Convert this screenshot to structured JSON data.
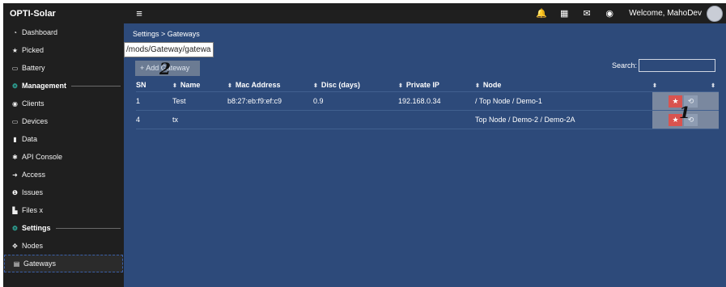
{
  "header": {
    "brand": "OPTI-Solar",
    "menu_icon": "≡",
    "icons": [
      {
        "name": "bell-icon",
        "glyph": "🔔"
      },
      {
        "name": "calendar-icon",
        "glyph": "▦"
      },
      {
        "name": "envelope-icon",
        "glyph": "✉"
      },
      {
        "name": "globe-icon",
        "glyph": "◉"
      }
    ],
    "welcome": "Welcome, MahoDev"
  },
  "sidebar": {
    "items": [
      {
        "label": "Dashboard",
        "icon": "◔"
      },
      {
        "label": "Picked",
        "icon": "★"
      },
      {
        "label": "Battery",
        "icon": "▭"
      }
    ],
    "section_management": {
      "label": "Management",
      "icon": "⚙"
    },
    "management_items": [
      {
        "label": "Clients",
        "icon": "◉"
      },
      {
        "label": "Devices",
        "icon": "▭"
      },
      {
        "label": "Data",
        "icon": "▮"
      },
      {
        "label": "API Console",
        "icon": "✱"
      },
      {
        "label": "Access",
        "icon": "➜"
      },
      {
        "label": "Issues",
        "icon": "❶"
      },
      {
        "label": "Files x",
        "icon": "▙"
      }
    ],
    "section_settings": {
      "label": "Settings",
      "icon": "⚙"
    },
    "settings_items": [
      {
        "label": "Nodes",
        "icon": "✥"
      },
      {
        "label": "Gateways",
        "icon": "▤"
      }
    ]
  },
  "main": {
    "breadcrumb": "Settings > Gateways",
    "path_overlay": "/mods/Gateway/gatewa",
    "add_button": "+ Add Gateway",
    "marker_1": "1",
    "marker_2": "2",
    "search_label": "Search:",
    "search_value": "",
    "columns": [
      "SN",
      "Name",
      "Mac Address",
      "Disc (days)",
      "Private IP",
      "Node",
      "",
      ""
    ],
    "rows": [
      {
        "sn": "1",
        "name": "Test",
        "mac": "b8:27:eb:f9:ef:c9",
        "disc": "0.9",
        "ip": "192.168.0.34",
        "node": "/ Top Node / Demo-1"
      },
      {
        "sn": "4",
        "name": "tx",
        "mac": "",
        "disc": "",
        "ip": "",
        "node": "Top Node / Demo-2 / Demo-2A"
      }
    ],
    "fav_icon": "★",
    "history_icon": "⟲",
    "sort_icon": "⬍"
  },
  "colors": {
    "topbar": "#1f1f1f",
    "main_bg": "#2d4a7a",
    "fav_button": "#d9534f",
    "action_cell": "#7a889f"
  }
}
